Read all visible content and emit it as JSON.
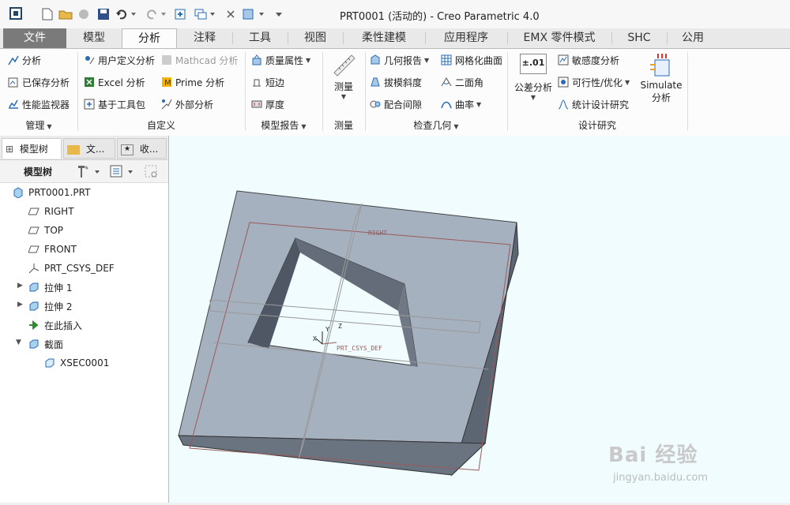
{
  "window": {
    "title": "PRT0001 (活动的) - Creo Parametric 4.0"
  },
  "tabs": [
    {
      "label": "文件"
    },
    {
      "label": "模型"
    },
    {
      "label": "分析"
    },
    {
      "label": "注释"
    },
    {
      "label": "工具"
    },
    {
      "label": "视图"
    },
    {
      "label": "柔性建模"
    },
    {
      "label": "应用程序"
    },
    {
      "label": "EMX 零件模式"
    },
    {
      "label": "SHC"
    },
    {
      "label": "公用"
    }
  ],
  "ribbon": {
    "manage": {
      "label": "管理",
      "items": [
        "分析",
        "已保存分析",
        "性能监视器"
      ]
    },
    "custom": {
      "label": "自定义",
      "items": [
        "用户定义分析",
        "Excel 分析",
        "基于工具包",
        "Mathcad 分析",
        "Prime 分析",
        "外部分析"
      ]
    },
    "model_report": {
      "label": "模型报告",
      "items": [
        "质量属性",
        "短边",
        "厚度"
      ]
    },
    "measure": {
      "label": "测量",
      "button": "测量"
    },
    "inspect": {
      "label": "检查几何",
      "items": [
        "几何报告",
        "拔模斜度",
        "配合间隙",
        "网格化曲面",
        "二面角",
        "曲率"
      ]
    },
    "design_study": {
      "label": "设计研究",
      "tolerance": "公差分析",
      "tolerance_icon_text": "±.01",
      "items": [
        "敏感度分析",
        "可行性/优化",
        "统计设计研究"
      ],
      "simulate_line1": "Simulate",
      "simulate_line2": "分析"
    }
  },
  "left_panel": {
    "tabs": [
      "模型树",
      "文...",
      "收..."
    ],
    "toolbar_label": "模型树",
    "tree": [
      {
        "label": "PRT0001.PRT",
        "icon": "part-icon"
      },
      {
        "label": "RIGHT",
        "icon": "datum-plane-icon"
      },
      {
        "label": "TOP",
        "icon": "datum-plane-icon"
      },
      {
        "label": "FRONT",
        "icon": "datum-plane-icon"
      },
      {
        "label": "PRT_CSYS_DEF",
        "icon": "csys-icon"
      },
      {
        "label": "拉伸 1",
        "icon": "extrude-icon"
      },
      {
        "label": "拉伸 2",
        "icon": "extrude-icon"
      },
      {
        "label": "在此插入",
        "icon": "insert-arrow-icon"
      },
      {
        "label": "截面",
        "icon": "section-icon"
      },
      {
        "label": "XSEC0001",
        "icon": "xsec-icon"
      }
    ]
  },
  "viewport": {
    "labels": {
      "right": "RIGHT",
      "csys": "PRT_CSYS_DEF",
      "x": "X",
      "y": "Y",
      "z": "Z"
    }
  },
  "watermark": {
    "brand": "Bai 经验",
    "url": "jingyan.baidu.com"
  },
  "colors": {
    "file_tab": "#7a7a7a",
    "viewport_bg": "#f0fcfd",
    "top_face": "#a6b1c0",
    "side_face": "#5c6572",
    "datum": "#9a5a5a"
  }
}
